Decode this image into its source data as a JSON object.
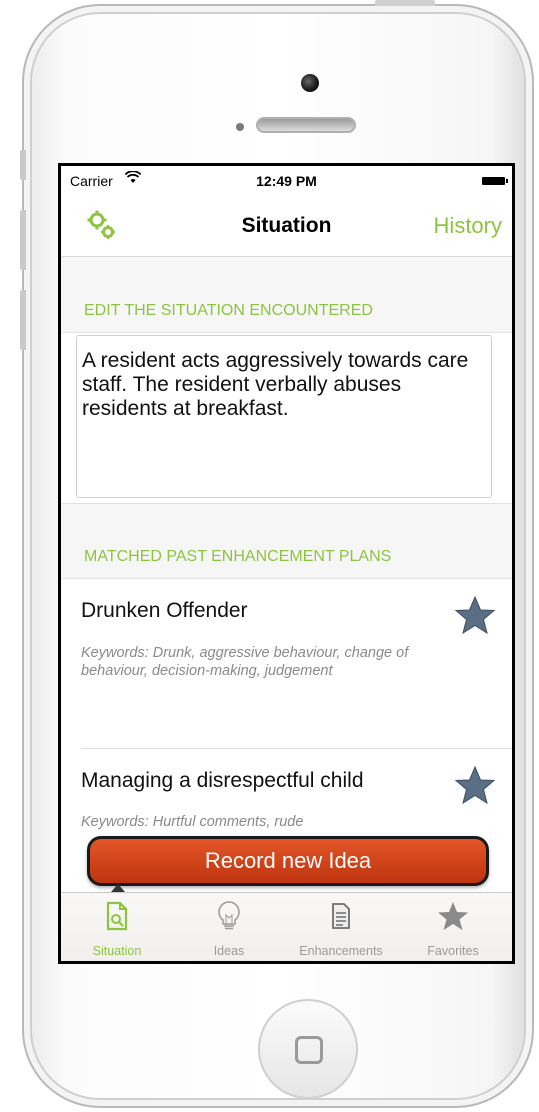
{
  "status_bar": {
    "carrier": "Carrier",
    "time": "12:49 PM"
  },
  "navbar": {
    "title": "Situation",
    "right_button": "History",
    "left_icon": "gear-icon"
  },
  "situation": {
    "header": "EDIT THE SITUATION ENCOUNTERED",
    "text": "A resident acts aggressively towards care staff. The resident verbally abuses residents at breakfast."
  },
  "plans": {
    "header": "MATCHED PAST ENHANCEMENT PLANS",
    "items": [
      {
        "title": "Drunken Offender",
        "keywords": "Keywords: Drunk, aggressive behaviour, change of behaviour, decision-making, judgement",
        "star_icon": "star-icon"
      },
      {
        "title": "Managing a disrespectful child",
        "keywords": "Keywords: Hurtful comments, rude",
        "star_icon": "star-icon"
      }
    ]
  },
  "record_button": "Record new Idea",
  "tabs": [
    {
      "label": "Situation",
      "icon": "document-search-icon",
      "active": true
    },
    {
      "label": "Ideas",
      "icon": "lightbulb-icon",
      "active": false
    },
    {
      "label": "Enhancements",
      "icon": "document-icon",
      "active": false
    },
    {
      "label": "Favorites",
      "icon": "star-icon",
      "active": false
    }
  ],
  "colors": {
    "accent_green": "#8dc43f",
    "record_red": "#d2461c",
    "star_blue_grey": "#5a6f86"
  }
}
